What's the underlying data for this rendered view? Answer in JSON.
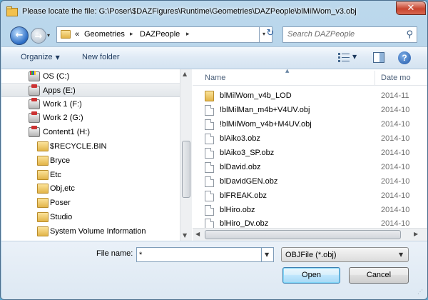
{
  "window": {
    "title": "Please locate the file: G:\\Poser\\$DAZFigures\\Runtime\\Geometries\\DAZPeople\\blMilWom_v3.obj",
    "close_glyph": "✕"
  },
  "nav": {
    "back_glyph": "←",
    "forward_glyph": "→",
    "history_drop": "▾",
    "address": {
      "overflow": "«",
      "segments": [
        "Geometries",
        "DAZPeople"
      ],
      "separator": "▸",
      "drop": "▾"
    },
    "refresh_glyph": "↻",
    "search": {
      "placeholder": "Search DAZPeople",
      "icon": "search-icon",
      "glyph": "⚲"
    }
  },
  "toolbar": {
    "organize_label": "Organize",
    "organize_caret": "▼",
    "new_folder_label": "New folder",
    "views_drop": "▼",
    "help_label": "?"
  },
  "nav_pane": {
    "items": [
      {
        "label": "OS (C:)",
        "icon": "drive-c-icon",
        "selected": false
      },
      {
        "label": "Apps (E:)",
        "icon": "network-drive-icon",
        "selected": true
      },
      {
        "label": "Work 1 (F:)",
        "icon": "network-drive-icon",
        "selected": false
      },
      {
        "label": "Work 2 (G:)",
        "icon": "network-drive-icon",
        "selected": false
      },
      {
        "label": "Content1 (H:)",
        "icon": "network-drive-icon",
        "selected": false
      },
      {
        "label": "$RECYCLE.BIN",
        "icon": "folder-icon",
        "selected": false
      },
      {
        "label": "Bryce",
        "icon": "folder-icon",
        "selected": false
      },
      {
        "label": "Etc",
        "icon": "folder-icon",
        "selected": false
      },
      {
        "label": "Obj,etc",
        "icon": "folder-icon",
        "selected": false
      },
      {
        "label": "Poser",
        "icon": "folder-icon",
        "selected": false
      },
      {
        "label": "Studio",
        "icon": "folder-icon",
        "selected": false
      },
      {
        "label": "System Volume Information",
        "icon": "folder-icon",
        "selected": false
      }
    ],
    "scroll_up": "▲",
    "scroll_down": "▼"
  },
  "file_pane": {
    "sort_arrow": "▲",
    "columns": {
      "name": "Name",
      "date": "Date mo"
    },
    "rows": [
      {
        "name": "blMilWom_v4b_LOD",
        "date": "2014-11",
        "icon": "folder-icon"
      },
      {
        "name": "!blMilMan_m4b+V4UV.obj",
        "date": "2014-10",
        "icon": "document-icon"
      },
      {
        "name": "!blMilWom_v4b+M4UV.obj",
        "date": "2014-10",
        "icon": "document-icon"
      },
      {
        "name": "blAiko3.obz",
        "date": "2014-10",
        "icon": "document-icon"
      },
      {
        "name": "blAiko3_SP.obz",
        "date": "2014-10",
        "icon": "document-icon"
      },
      {
        "name": "blDavid.obz",
        "date": "2014-10",
        "icon": "document-icon"
      },
      {
        "name": "blDavidGEN.obz",
        "date": "2014-10",
        "icon": "document-icon"
      },
      {
        "name": "blFREAK.obz",
        "date": "2014-10",
        "icon": "document-icon"
      },
      {
        "name": "blHiro.obz",
        "date": "2014-10",
        "icon": "document-icon"
      },
      {
        "name": "blHiro_Dv.obz",
        "date": "2014-10",
        "icon": "document-icon"
      }
    ],
    "scroll_left": "◀",
    "scroll_right": "▶"
  },
  "bottom": {
    "file_name_label": "File name:",
    "file_name_value": "*",
    "file_name_drop": "▼",
    "file_type_value": "OBJFile (*.obj)",
    "file_type_drop": "▼",
    "open_label": "Open",
    "cancel_label": "Cancel",
    "grip": "⋰"
  },
  "colors": {
    "accent": "#3c7fb1",
    "titlebar": "#a9cde6",
    "close": "#c8452f",
    "selection": "#e2e6ea"
  }
}
